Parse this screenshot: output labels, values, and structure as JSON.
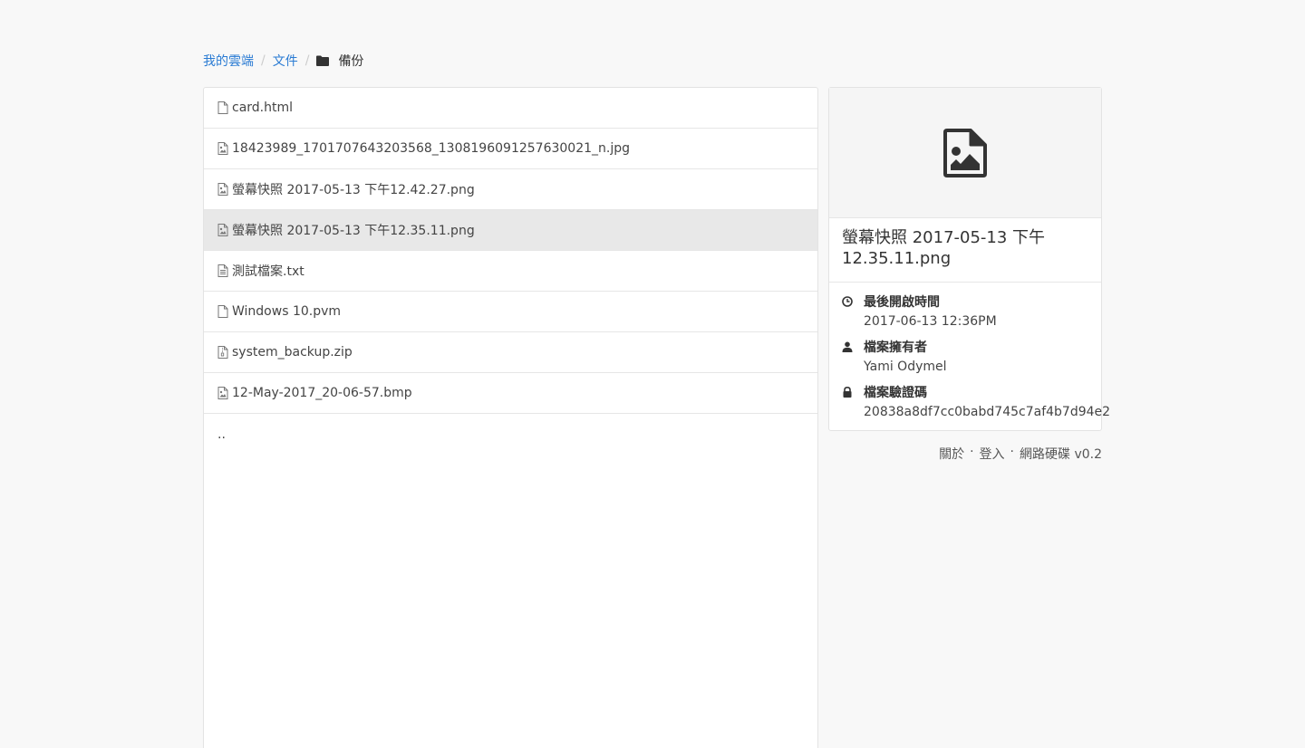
{
  "breadcrumb": {
    "items": [
      "我的雲端",
      "文件"
    ],
    "current": "備份"
  },
  "files": [
    {
      "name": "card.html",
      "icon": "file-icon"
    },
    {
      "name": "18423989_1701707643203568_1308196091257630021_n.jpg",
      "icon": "image-file-icon"
    },
    {
      "name": "螢幕快照 2017-05-13 下午12.42.27.png",
      "icon": "image-file-icon"
    },
    {
      "name": "螢幕快照 2017-05-13 下午12.35.11.png",
      "icon": "image-file-icon",
      "selected": true
    },
    {
      "name": "測試檔案.txt",
      "icon": "text-file-icon"
    },
    {
      "name": "Windows 10.pvm",
      "icon": "file-icon"
    },
    {
      "name": "system_backup.zip",
      "icon": "archive-file-icon"
    },
    {
      "name": "12-May-2017_20-06-57.bmp",
      "icon": "image-file-icon"
    }
  ],
  "parent_dir": "..",
  "detail": {
    "title": "螢幕快照 2017-05-13 下午12.35.11.png",
    "last_opened_label": "最後開啟時間",
    "last_opened_value": "2017-06-13 12:36PM",
    "owner_label": "檔案擁有者",
    "owner_value": "Yami Odymel",
    "checksum_label": "檔案驗證碼",
    "checksum_value": "20838a8df7cc0babd745c7af4b7d94e2"
  },
  "footer": {
    "about": "關於",
    "login": "登入",
    "brand": "網路硬碟 v0.2",
    "separator": "·"
  },
  "colors": {
    "link": "#2a7bd3",
    "selected_row": "#e8e8e8",
    "background": "#f8f8f8"
  }
}
